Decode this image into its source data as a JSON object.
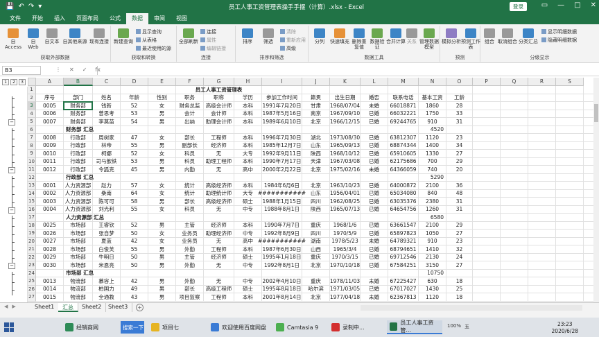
{
  "window": {
    "title": "员工人事工资管理表操手手揠（计算）.xlsx - Excel",
    "login_label": "登录",
    "controls": [
      "▭",
      "—",
      "□",
      "✕"
    ]
  },
  "tabs": [
    "文件",
    "开始",
    "插入",
    "页面布局",
    "公式",
    "数据",
    "审阅",
    "视图"
  ],
  "active_tab": "数据",
  "ribbon": {
    "groups": [
      {
        "title": "获取外部数据",
        "buttons": [
          "自 Access",
          "自 Web",
          "自文本",
          "自其他来源",
          "现有连接"
        ]
      },
      {
        "title": "获取和转换",
        "buttons": [
          "新建查询"
        ],
        "small": [
          "显示查询",
          "从表格",
          "最近使用的源"
        ]
      },
      {
        "title": "连接",
        "buttons": [
          "全部刷新"
        ],
        "small": [
          "连接",
          "属性",
          "编辑链接"
        ]
      },
      {
        "title": "排序和筛选",
        "buttons": [
          "排序",
          "筛选"
        ],
        "small": [
          "清除",
          "重新应用",
          "高级"
        ]
      },
      {
        "title": "数据工具",
        "buttons": [
          "分列",
          "快速填充",
          "删除重复值",
          "数据验证",
          "合并计算",
          "关系",
          "管理数据模型"
        ]
      },
      {
        "title": "预测",
        "buttons": [
          "模拟分析",
          "预测工作表"
        ]
      },
      {
        "title": "分级显示",
        "buttons": [
          "组合",
          "取消组合",
          "分类汇总"
        ],
        "small": [
          "显示明细数据",
          "隐藏明细数据"
        ]
      }
    ]
  },
  "formula_bar": {
    "name_box": "B3",
    "icons": [
      "⋮",
      "✕",
      "✓",
      "fx"
    ],
    "formula": ""
  },
  "outline_levels": [
    "1",
    "2",
    "3"
  ],
  "columns": [
    "A",
    "B",
    "C",
    "D",
    "E",
    "F",
    "G",
    "H",
    "I",
    "J",
    "K",
    "L",
    "M",
    "N",
    "O",
    "P",
    "Q",
    "R",
    "S"
  ],
  "selected_cell": {
    "col": "B",
    "row": "3"
  },
  "rows": [
    {
      "n": "1",
      "cells": {
        "A": "",
        "B": "",
        "C": "",
        "D": "",
        "E": "",
        "F": "",
        "G": "员工人事工资管理表",
        "H": "",
        "I": "",
        "J": "",
        "K": "",
        "L": "",
        "M": "",
        "N": "",
        "O": ""
      }
    },
    {
      "n": "2",
      "cells": {
        "A": "序号",
        "B": "部门",
        "C": "姓名",
        "D": "年龄",
        "E": "性别",
        "F": "职务",
        "G": "职称",
        "H": "学历",
        "I": "参加工作时间",
        "J": "籍贯",
        "K": "出生日期",
        "L": "婚否",
        "M": "联系电话",
        "N": "基本工资",
        "O": "工龄"
      }
    },
    {
      "n": "3",
      "cells": {
        "A": "0005",
        "B": "财务部",
        "C": "钱新",
        "D": "52",
        "E": "女",
        "F": "财务总监",
        "G": "高级会计师",
        "H": "本科",
        "I": "1991年7月20日",
        "J": "甘肃",
        "K": "1968/07/04",
        "L": "未婚",
        "M": "66018871",
        "N": "1860",
        "O": "28"
      }
    },
    {
      "n": "4",
      "cells": {
        "A": "0006",
        "B": "财务部",
        "C": "曾思考",
        "D": "53",
        "E": "男",
        "F": "会计",
        "G": "会计师",
        "H": "本科",
        "I": "1987年5月16日",
        "J": "南京",
        "K": "1967/09/10",
        "L": "已婚",
        "M": "66032221",
        "N": "1750",
        "O": "33"
      }
    },
    {
      "n": "5",
      "cells": {
        "A": "0007",
        "B": "财务部",
        "C": "李莫苗",
        "D": "54",
        "E": "男",
        "F": "出纳",
        "G": "助理会计师",
        "H": "本科",
        "I": "1989年6月10日",
        "J": "北京",
        "K": "1966/12/15",
        "L": "已婚",
        "M": "69244765",
        "N": "910",
        "O": "31"
      }
    },
    {
      "n": "6",
      "cells": {
        "A": "",
        "B": "财务部 汇总",
        "C": "",
        "D": "",
        "E": "",
        "F": "",
        "G": "",
        "H": "",
        "I": "",
        "J": "",
        "K": "",
        "L": "",
        "M": "",
        "N": "4520",
        "O": ""
      },
      "summary": true
    },
    {
      "n": "7",
      "cells": {
        "A": "0008",
        "B": "行政部",
        "C": "周树家",
        "D": "47",
        "E": "女",
        "F": "部长",
        "G": "工程师",
        "H": "本科",
        "I": "1996年7月30日",
        "J": "湖北",
        "K": "1973/08/30",
        "L": "已婚",
        "M": "63812307",
        "N": "1120",
        "O": "23"
      }
    },
    {
      "n": "8",
      "cells": {
        "A": "0009",
        "B": "行政部",
        "C": "林帝",
        "D": "55",
        "E": "男",
        "F": "副部长",
        "G": "经济师",
        "H": "本科",
        "I": "1985年12月7日",
        "J": "山东",
        "K": "1965/09/13",
        "L": "已婚",
        "M": "68874344",
        "N": "1400",
        "O": "34"
      }
    },
    {
      "n": "9",
      "cells": {
        "A": "0010",
        "B": "行政部",
        "C": "柯娜",
        "D": "52",
        "E": "女",
        "F": "科员",
        "G": "无",
        "H": "大专",
        "I": "1992年9月11日",
        "J": "陕西",
        "K": "1968/10/12",
        "L": "已婚",
        "M": "65910605",
        "N": "1330",
        "O": "27"
      }
    },
    {
      "n": "10",
      "cells": {
        "A": "0011",
        "B": "行政部",
        "C": "司马歆铁",
        "D": "53",
        "E": "男",
        "F": "科员",
        "G": "助理工程师",
        "H": "本科",
        "I": "1990年7月17日",
        "J": "天津",
        "K": "1967/03/08",
        "L": "已婚",
        "M": "62175686",
        "N": "700",
        "O": "29"
      }
    },
    {
      "n": "11",
      "cells": {
        "A": "0012",
        "B": "行政部",
        "C": "令狐克",
        "D": "45",
        "E": "男",
        "F": "内勤",
        "G": "无",
        "H": "高中",
        "I": "2000年2月22日",
        "J": "北京",
        "K": "1975/02/16",
        "L": "未婚",
        "M": "64366059",
        "N": "740",
        "O": "20"
      }
    },
    {
      "n": "12",
      "cells": {
        "A": "",
        "B": "行政部 汇总",
        "C": "",
        "D": "",
        "E": "",
        "F": "",
        "G": "",
        "H": "",
        "I": "",
        "J": "",
        "K": "",
        "L": "",
        "M": "",
        "N": "5290",
        "O": ""
      },
      "summary": true
    },
    {
      "n": "13",
      "cells": {
        "A": "0001",
        "B": "人力资源部",
        "C": "赵力",
        "D": "57",
        "E": "女",
        "F": "统计",
        "G": "高级经济师",
        "H": "本科",
        "I": "1984年6月6日",
        "J": "北京",
        "K": "1963/10/23",
        "L": "已婚",
        "M": "64000872",
        "N": "2100",
        "O": "36"
      }
    },
    {
      "n": "14",
      "cells": {
        "A": "0002",
        "B": "人力资源部",
        "C": "桑南",
        "D": "64",
        "E": "女",
        "F": "统计",
        "G": "助理统计师",
        "H": "大专",
        "I": "###########",
        "J": "山东",
        "K": "1956/04/01",
        "L": "已婚",
        "M": "65034080",
        "N": "840",
        "O": "48"
      }
    },
    {
      "n": "15",
      "cells": {
        "A": "0003",
        "B": "人力资源部",
        "C": "陈可可",
        "D": "58",
        "E": "男",
        "F": "部长",
        "G": "高级经济师",
        "H": "硕士",
        "I": "1988年1月15日",
        "J": "四川",
        "K": "1962/08/25",
        "L": "已婚",
        "M": "63035376",
        "N": "2380",
        "O": "31"
      }
    },
    {
      "n": "16",
      "cells": {
        "A": "0004",
        "B": "人力资源部",
        "C": "刘光利",
        "D": "55",
        "E": "女",
        "F": "科员",
        "G": "无",
        "H": "中专",
        "I": "1988年8月1日",
        "J": "陕西",
        "K": "1965/07/13",
        "L": "已婚",
        "M": "64654756",
        "N": "1260",
        "O": "31"
      }
    },
    {
      "n": "17",
      "cells": {
        "A": "",
        "B": "人力资源部 汇总",
        "C": "",
        "D": "",
        "E": "",
        "F": "",
        "G": "",
        "H": "",
        "I": "",
        "J": "",
        "K": "",
        "L": "",
        "M": "",
        "N": "6580",
        "O": ""
      },
      "summary": true
    },
    {
      "n": "18",
      "cells": {
        "A": "0025",
        "B": "市场部",
        "C": "王睿钦",
        "D": "52",
        "E": "男",
        "F": "主管",
        "G": "经济师",
        "H": "本科",
        "I": "1990年7月7日",
        "J": "重庆",
        "K": "1968/1/6",
        "L": "已婚",
        "M": "63661547",
        "N": "2100",
        "O": "29"
      }
    },
    {
      "n": "19",
      "cells": {
        "A": "0026",
        "B": "市场部",
        "C": "张自梦",
        "D": "50",
        "E": "女",
        "F": "业务员",
        "G": "助理经济师",
        "H": "中专",
        "I": "1992年8月9日",
        "J": "四川",
        "K": "1970/5/9",
        "L": "已婚",
        "M": "65897823",
        "N": "1050",
        "O": "27"
      }
    },
    {
      "n": "20",
      "cells": {
        "A": "0027",
        "B": "市场部",
        "C": "夏蓝",
        "D": "42",
        "E": "女",
        "F": "业务员",
        "G": "无",
        "H": "高中",
        "I": "###########",
        "J": "湖南",
        "K": "1978/5/23",
        "L": "未婚",
        "M": "64789321",
        "N": "910",
        "O": "23"
      }
    },
    {
      "n": "21",
      "cells": {
        "A": "0028",
        "B": "市场部",
        "C": "白俊芙",
        "D": "55",
        "E": "男",
        "F": "外勤",
        "G": "工程师",
        "H": "本科",
        "I": "1987年6月30日",
        "J": "山西",
        "K": "1965/3/4",
        "L": "已婚",
        "M": "68794651",
        "N": "1410",
        "O": "32"
      }
    },
    {
      "n": "22",
      "cells": {
        "A": "0029",
        "B": "市场部",
        "C": "牛明日",
        "D": "50",
        "E": "男",
        "F": "主管",
        "G": "经济师",
        "H": "硕士",
        "I": "1995年1月18日",
        "J": "重庆",
        "K": "1970/3/15",
        "L": "已婚",
        "M": "69712546",
        "N": "2130",
        "O": "24"
      }
    },
    {
      "n": "23",
      "cells": {
        "A": "0030",
        "B": "市场部",
        "C": "米恩亮",
        "D": "50",
        "E": "男",
        "F": "外勤",
        "G": "无",
        "H": "中专",
        "I": "1992年8月1日",
        "J": "北京",
        "K": "1970/10/18",
        "L": "已婚",
        "M": "67584251",
        "N": "3150",
        "O": "27"
      }
    },
    {
      "n": "24",
      "cells": {
        "A": "",
        "B": "市场部 汇总",
        "C": "",
        "D": "",
        "E": "",
        "F": "",
        "G": "",
        "H": "",
        "I": "",
        "J": "",
        "K": "",
        "L": "",
        "M": "",
        "N": "10750",
        "O": ""
      },
      "summary": true
    },
    {
      "n": "25",
      "cells": {
        "A": "0013",
        "B": "物流部",
        "C": "慕容上",
        "D": "42",
        "E": "男",
        "F": "外勤",
        "G": "无",
        "H": "中专",
        "I": "2002年4月10日",
        "J": "重庆",
        "K": "1978/11/03",
        "L": "未婚",
        "M": "67225427",
        "N": "630",
        "O": "18"
      }
    },
    {
      "n": "26",
      "cells": {
        "A": "0014",
        "B": "物流部",
        "C": "柏国力",
        "D": "49",
        "E": "男",
        "F": "部长",
        "G": "高级工程师",
        "H": "硕士",
        "I": "1995年8月18日",
        "J": "哈尔滨",
        "K": "1971/03/05",
        "L": "已婚",
        "M": "67017027",
        "N": "1430",
        "O": "25"
      }
    },
    {
      "n": "27",
      "cells": {
        "A": "0015",
        "B": "物流部",
        "C": "全通教",
        "D": "43",
        "E": "男",
        "F": "项目监察",
        "G": "工程师",
        "H": "本科",
        "I": "2001年8月14日",
        "J": "北京",
        "K": "1977/04/18",
        "L": "未婚",
        "M": "62367813",
        "N": "1120",
        "O": "18"
      }
    }
  ],
  "sheets": [
    "Sheet1",
    "汇总",
    "Sheet2",
    "Sheet3"
  ],
  "active_sheet": "汇总",
  "taskbar": {
    "search_label": "搜索一下",
    "items": [
      "经销商网",
      "项目七",
      "欢迎使用百度网盘",
      "Camtasia 9",
      "录制中...",
      "员工人事工资管..."
    ],
    "active_item": "员工人事工资管...",
    "time": "23:23",
    "date": "2020/6/28",
    "battery": "100%",
    "ime": "五"
  }
}
